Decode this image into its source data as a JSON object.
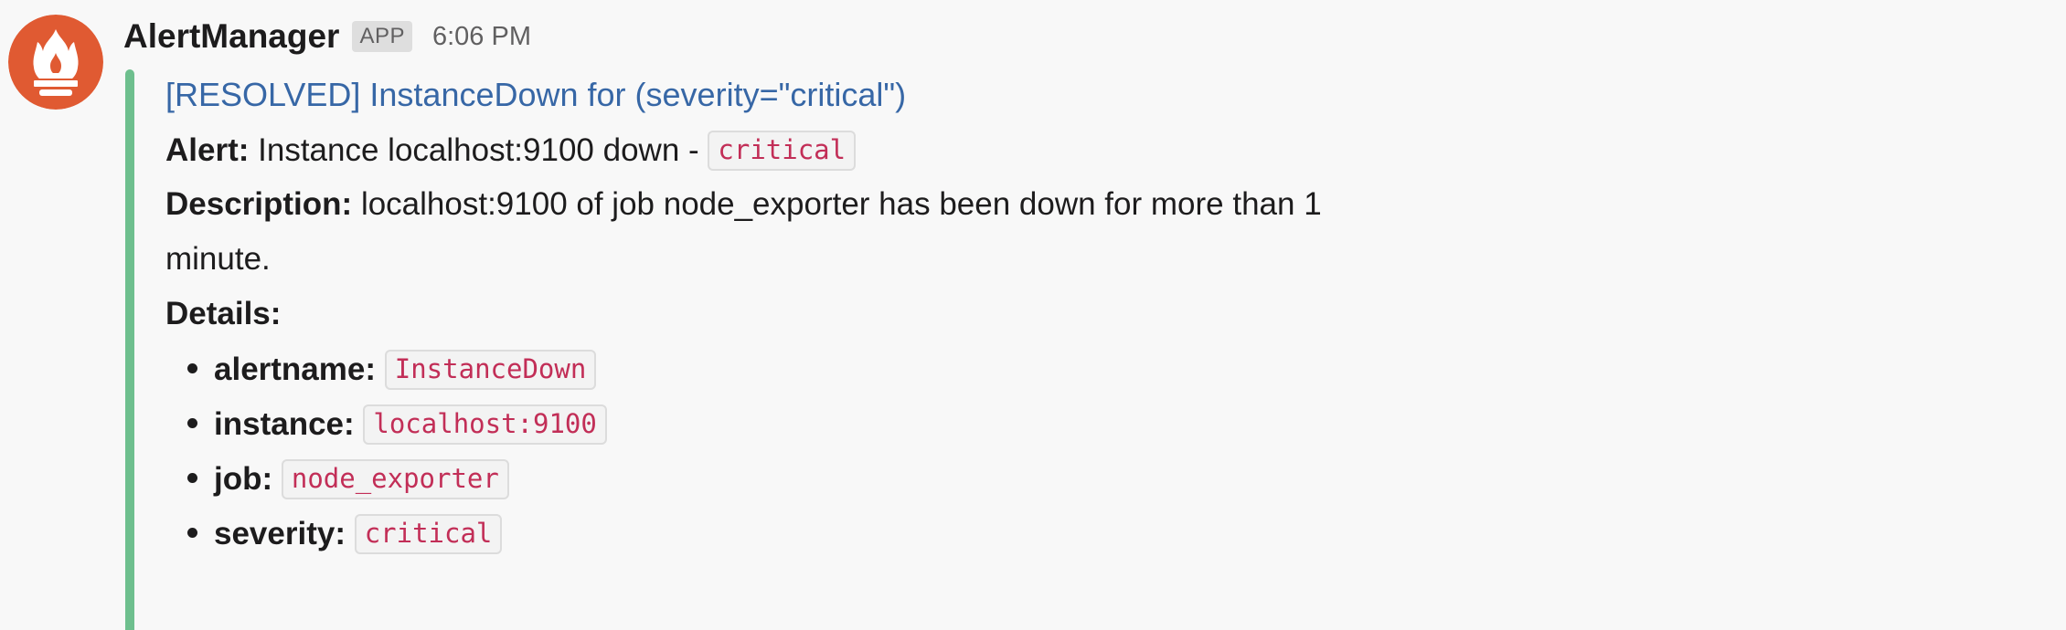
{
  "message": {
    "sender": "AlertManager",
    "badge": "APP",
    "time": "6:06 PM",
    "avatar_icon": "prometheus-flame-icon",
    "accent_color": "#6ebf8e",
    "title": "[RESOLVED] InstanceDown for  (severity=\"critical\")",
    "alert": {
      "label": "Alert:",
      "text": "Instance localhost:9100 down -",
      "tag": "critical"
    },
    "description": {
      "label": "Description:",
      "line1": "localhost:9100 of job node_exporter has been down for more than 1",
      "line2": "minute."
    },
    "details": {
      "label": "Details:",
      "items": [
        {
          "key": "alertname:",
          "value": "InstanceDown"
        },
        {
          "key": "instance:",
          "value": "localhost:9100"
        },
        {
          "key": "job:",
          "value": "node_exporter"
        },
        {
          "key": "severity:",
          "value": "critical"
        }
      ]
    }
  }
}
